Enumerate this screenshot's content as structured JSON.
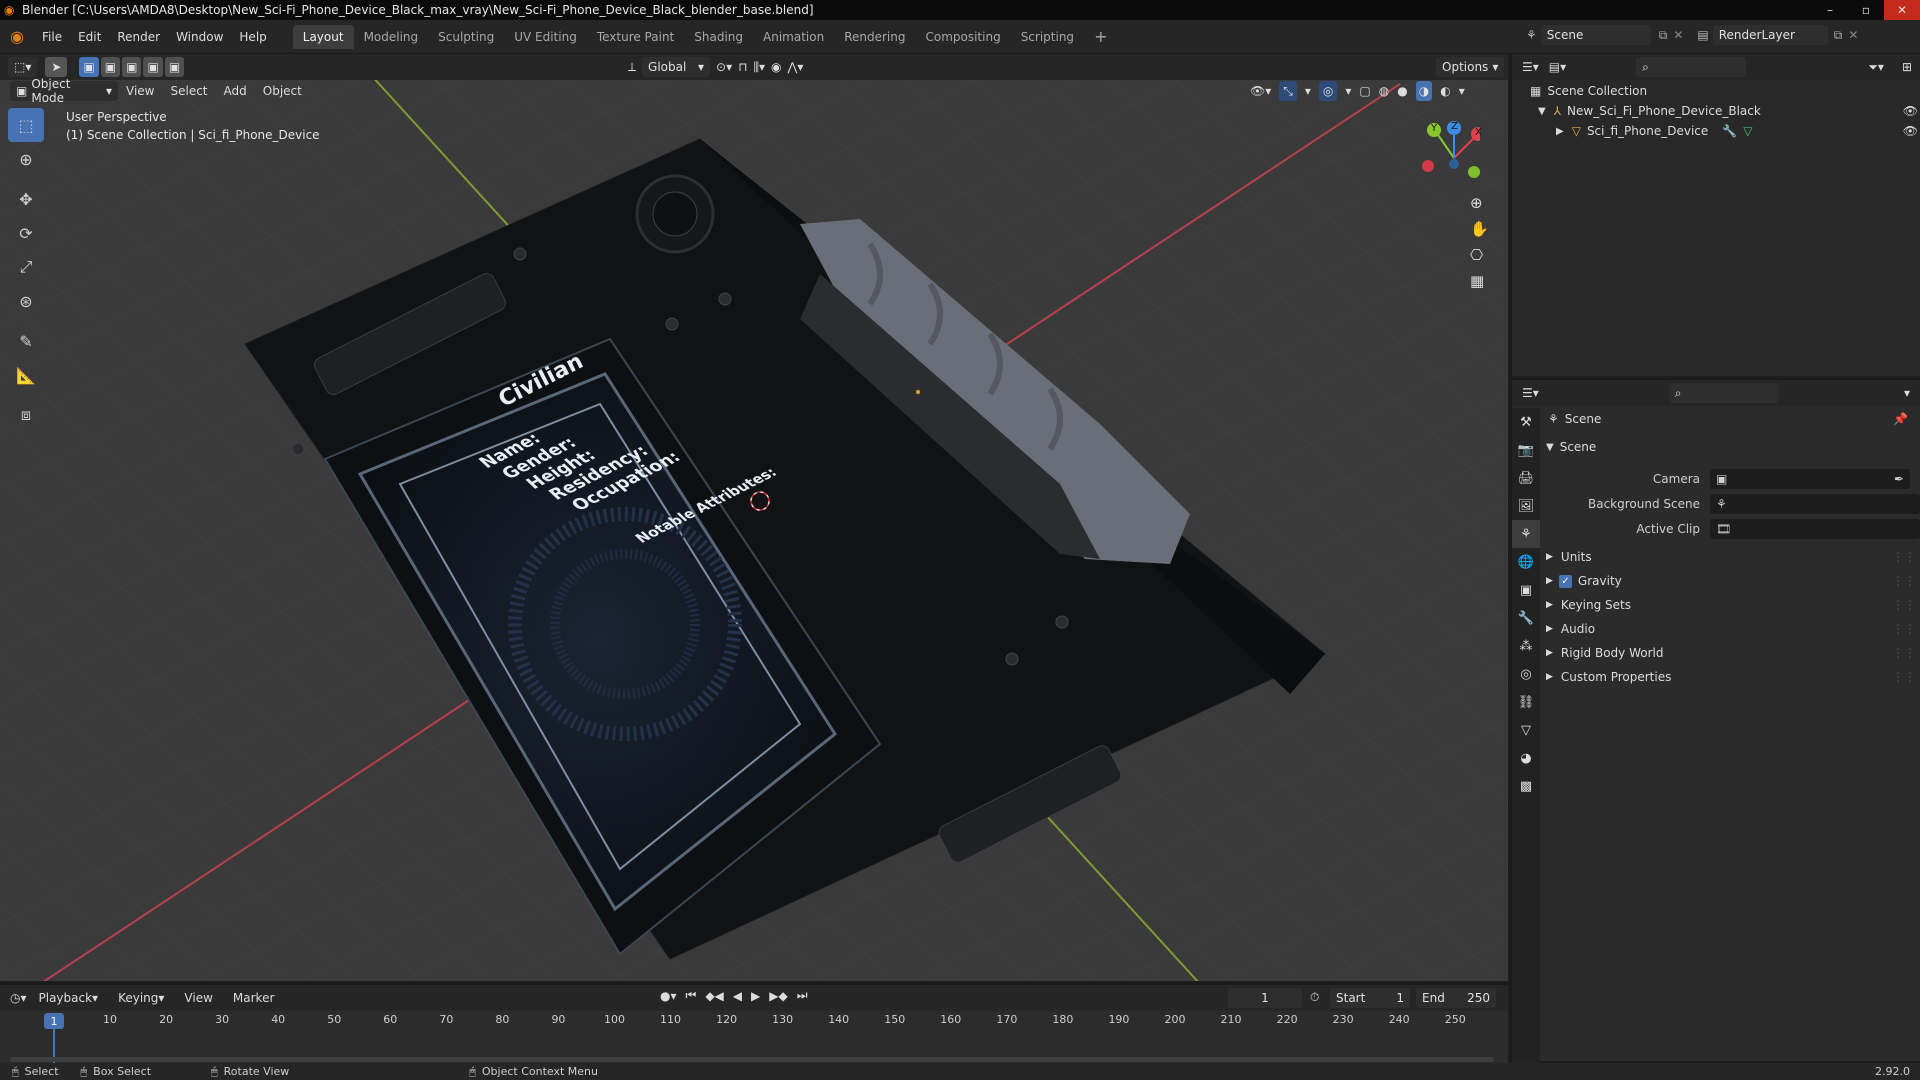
{
  "window": {
    "title": "Blender [C:\\Users\\AMDA8\\Desktop\\New_Sci-Fi_Phone_Device_Black_max_vray\\New_Sci-Fi_Phone_Device_Black_blender_base.blend]",
    "minimize": "–",
    "maximize": "▫",
    "close": "✕"
  },
  "menus": [
    "File",
    "Edit",
    "Render",
    "Window",
    "Help"
  ],
  "workspaces": [
    "Layout",
    "Modeling",
    "Sculpting",
    "UV Editing",
    "Texture Paint",
    "Shading",
    "Animation",
    "Rendering",
    "Compositing",
    "Scripting"
  ],
  "workspace_add": "+",
  "scene_selector": {
    "value": "Scene"
  },
  "render_layer": {
    "value": "RenderLayer"
  },
  "viewport_header": {
    "transform_orientation": "Global",
    "options_label": "Options",
    "mode": "Object Mode",
    "menus": [
      "View",
      "Select",
      "Add",
      "Object"
    ]
  },
  "viewport": {
    "perspective_label": "User Perspective",
    "collection_label": "(1) Scene Collection | Sci_fi_Phone_Device",
    "screen_text": {
      "title": "Civilian",
      "fields": [
        "Name:",
        "Gender:",
        "Height:",
        "Residency:",
        "Occupation:"
      ],
      "notable": "Notable Attributes:"
    },
    "gizmo_axes": [
      "X",
      "Y",
      "Z"
    ]
  },
  "toolbar_icons": [
    "select-box-icon",
    "cursor-icon",
    "move-icon",
    "rotate-icon",
    "scale-icon",
    "transform-icon",
    "annotate-icon",
    "measure-icon",
    "add-cube-icon"
  ],
  "outliner": {
    "root": "Scene Collection",
    "collection": "New_Sci_Fi_Phone_Device_Black",
    "object": "Sci_fi_Phone_Device"
  },
  "properties": {
    "context_label": "Scene",
    "panel_title": "Scene",
    "camera_label": "Camera",
    "background_scene_label": "Background Scene",
    "active_clip_label": "Active Clip",
    "subpanels": [
      "Units",
      "Gravity",
      "Keying Sets",
      "Audio",
      "Rigid Body World",
      "Custom Properties"
    ],
    "gravity_checked": true
  },
  "timeline": {
    "menus": [
      "Playback",
      "Keying",
      "View",
      "Marker"
    ],
    "current_frame": "1",
    "start_label": "Start",
    "start": "1",
    "end_label": "End",
    "end": "250",
    "ticks": [
      "10",
      "20",
      "30",
      "40",
      "50",
      "60",
      "70",
      "80",
      "90",
      "100",
      "110",
      "120",
      "130",
      "140",
      "150",
      "160",
      "170",
      "180",
      "190",
      "200",
      "210",
      "220",
      "230",
      "240",
      "250"
    ],
    "playhead_label": "1"
  },
  "statusbar": {
    "select": "Select",
    "box_select": "Box Select",
    "rotate_view": "Rotate View",
    "context_menu": "Object Context Menu",
    "version": "2.92.0"
  },
  "colors": {
    "accent": "#4772b3",
    "x_axis": "#e0414f",
    "y_axis": "#8ac92d",
    "z_axis": "#3b8ee3",
    "playhead": "#4772b3"
  }
}
